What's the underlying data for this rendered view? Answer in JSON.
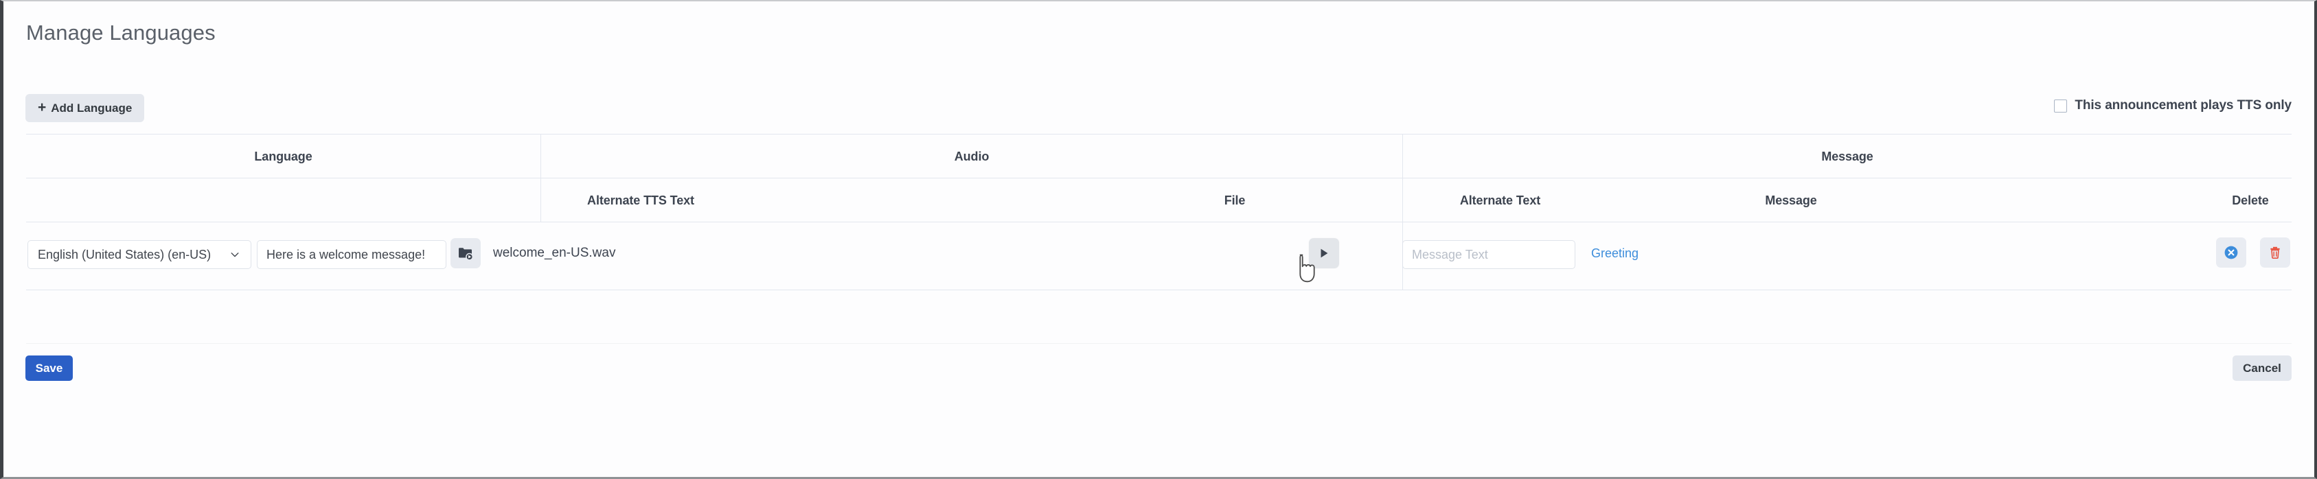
{
  "page": {
    "title": "Manage Languages"
  },
  "toolbar": {
    "add_language_label": "Add Language",
    "add_language_plus": "+",
    "tts_only_label": "This announcement plays TTS only",
    "tts_only_checked": false
  },
  "table": {
    "group_headers": [
      {
        "label": "Language"
      },
      {
        "label": "Audio"
      },
      {
        "label": "Message"
      }
    ],
    "sub_headers": [
      {
        "label": "Alternate TTS Text"
      },
      {
        "label": "File"
      },
      {
        "label": "Alternate Text"
      },
      {
        "label": "Message"
      },
      {
        "label": "Delete"
      }
    ],
    "rows": [
      {
        "language": "English (United States) (en-US)",
        "alternate_tts_text": "Here is a welcome message!",
        "file_name": "welcome_en-US.wav",
        "message_alternate_text_value": "",
        "message_alternate_text_placeholder": "Message Text",
        "message_link": "Greeting"
      }
    ]
  },
  "footer": {
    "save_label": "Save",
    "cancel_label": "Cancel"
  },
  "colors": {
    "primary": "#2b5fc6",
    "link": "#3d8ddb",
    "danger": "#e8523f",
    "clear": "#3d8ddb",
    "muted_button": "#e5e8ee",
    "border": "#e3e7ef"
  }
}
